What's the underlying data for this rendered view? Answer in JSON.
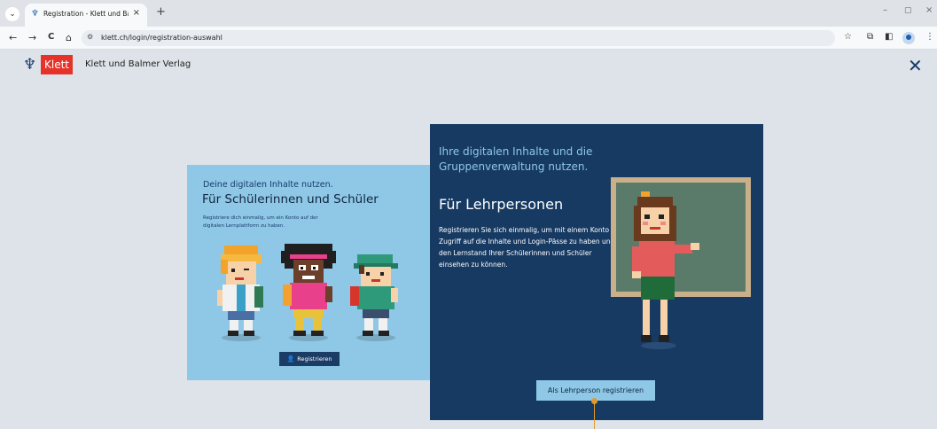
{
  "browser": {
    "tab_title": "Registration - Klett und Balmer",
    "tab_close": "×",
    "new_tab": "+",
    "url": "klett.ch/login/registration-auswahl",
    "nav": {
      "back": "←",
      "forward": "→",
      "reload": "C",
      "home": "⌂"
    },
    "window": {
      "minimize": "–",
      "maximize": "▢",
      "close": "×"
    }
  },
  "header": {
    "logo_text": "Klett",
    "brand": "Klett und Balmer Verlag",
    "close": "✕"
  },
  "student": {
    "kicker": "Deine digitalen Inhalte nutzen.",
    "title": "Für Schülerinnen und Schüler",
    "description": "Registriere dich einmalig, um ein Konto auf der digitalen Lernplattform zu haben.",
    "button_label": "Registrieren"
  },
  "teacher": {
    "kicker": "Ihre digitalen Inhalte und die Gruppenverwaltung nutzen.",
    "title": "Für Lehrpersonen",
    "description": "Registrieren Sie sich einmalig, um mit einem Konto Zugriff auf die Inhalte und Login-Pässe zu haben und den Lernstand Ihrer Schülerinnen und Schüler einsehen zu können.",
    "button_label": "Als Lehrperson registrieren"
  },
  "colors": {
    "student_card": "#8ec8e6",
    "teacher_card": "#173a63",
    "brand_red": "#e5332a",
    "brand_blue": "#1a3a6b"
  }
}
